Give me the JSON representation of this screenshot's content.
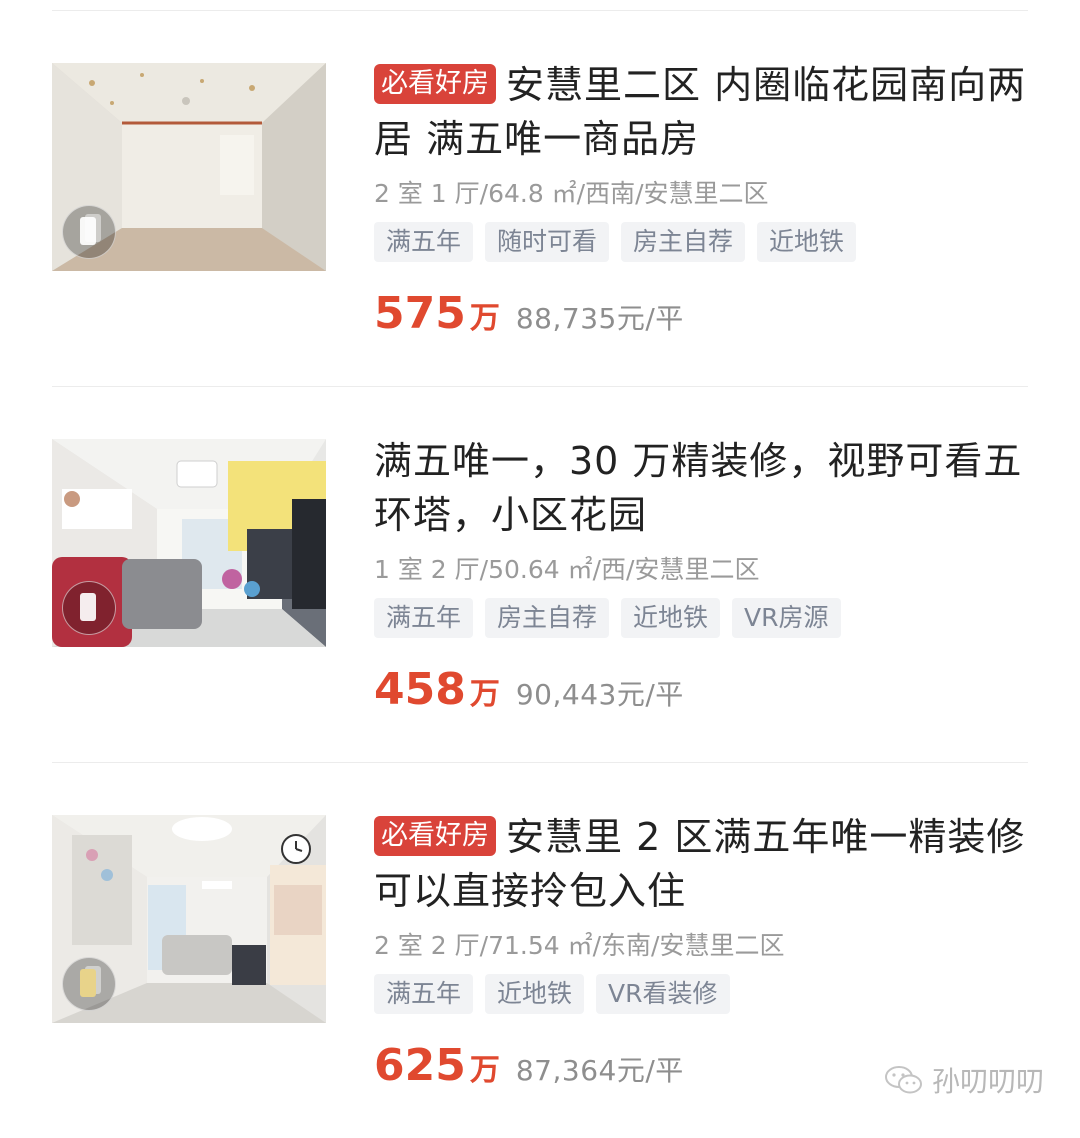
{
  "listings": [
    {
      "badge": "必看好房",
      "title": "安慧里二区 内圈临花园南向两居 满五唯一商品房",
      "meta": "2 室 1 厅/64.8 ㎡/西南/安慧里二区",
      "tags": [
        "满五年",
        "随时可看",
        "房主自荐",
        "近地铁"
      ],
      "price": "575",
      "price_unit": "万",
      "unit_price": "88,735元/平"
    },
    {
      "badge": "",
      "title": "满五唯一，30 万精装修，视野可看五环塔，小区花园",
      "meta": "1 室 2 厅/50.64 ㎡/西/安慧里二区",
      "tags": [
        "满五年",
        "房主自荐",
        "近地铁",
        "VR房源"
      ],
      "price": "458",
      "price_unit": "万",
      "unit_price": "90,443元/平"
    },
    {
      "badge": "必看好房",
      "title": "安慧里 2 区满五年唯一精装修可以直接拎包入住",
      "meta": "2 室 2 厅/71.54 ㎡/东南/安慧里二区",
      "tags": [
        "满五年",
        "近地铁",
        "VR看装修"
      ],
      "price": "625",
      "price_unit": "万",
      "unit_price": "87,364元/平"
    }
  ],
  "watermark": {
    "text": "孙叨叨叨",
    "icon": "wechat-icon"
  },
  "colors": {
    "accent": "#e0492f",
    "badge_bg": "#d9433a",
    "tag_bg": "#f2f3f5",
    "tag_text": "#7d8594",
    "meta_text": "#9a9a9a"
  }
}
